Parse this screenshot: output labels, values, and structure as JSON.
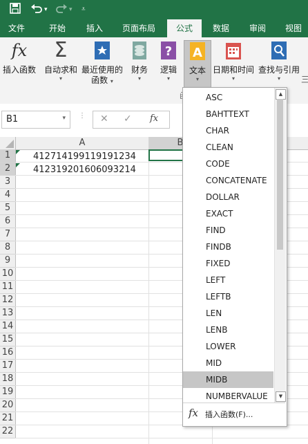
{
  "quick_access": {
    "save_icon": "save-icon",
    "undo_icon": "undo-icon",
    "redo_icon": "redo-icon"
  },
  "tabs": [
    {
      "label": "文件"
    },
    {
      "label": "开始"
    },
    {
      "label": "插入"
    },
    {
      "label": "页面布局"
    },
    {
      "label": "公式",
      "active": true
    },
    {
      "label": "数据"
    },
    {
      "label": "审阅"
    },
    {
      "label": "视图"
    }
  ],
  "ribbon": {
    "insert_function": "插入函数",
    "autosum": "自动求和",
    "recent_line1": "最近使用的",
    "recent_line2": "函数",
    "financial": "财务",
    "logical": "逻辑",
    "text": "文本",
    "datetime": "日期和时间",
    "lookup": "查找与引用",
    "more": "三",
    "group_label": "函"
  },
  "formula_bar": {
    "name_box": "B1",
    "fx": "fx"
  },
  "columns": [
    "A",
    "B"
  ],
  "rows": [
    "1",
    "2",
    "3",
    "4",
    "5",
    "6",
    "7",
    "8",
    "9",
    "10",
    "11",
    "12",
    "13",
    "14",
    "15",
    "16",
    "17",
    "18",
    "19",
    "20",
    "21",
    "22"
  ],
  "cells": {
    "A1": "412714199119191234",
    "A2": "412319201606093214"
  },
  "text_functions": [
    "ASC",
    "BAHTTEXT",
    "CHAR",
    "CLEAN",
    "CODE",
    "CONCATENATE",
    "DOLLAR",
    "EXACT",
    "FIND",
    "FINDB",
    "FIXED",
    "LEFT",
    "LEFTB",
    "LEN",
    "LENB",
    "LOWER",
    "MID",
    "MIDB",
    "NUMBERVALUE"
  ],
  "highlighted_function": "MIDB",
  "insert_function_menu": "插入函数(F)..."
}
